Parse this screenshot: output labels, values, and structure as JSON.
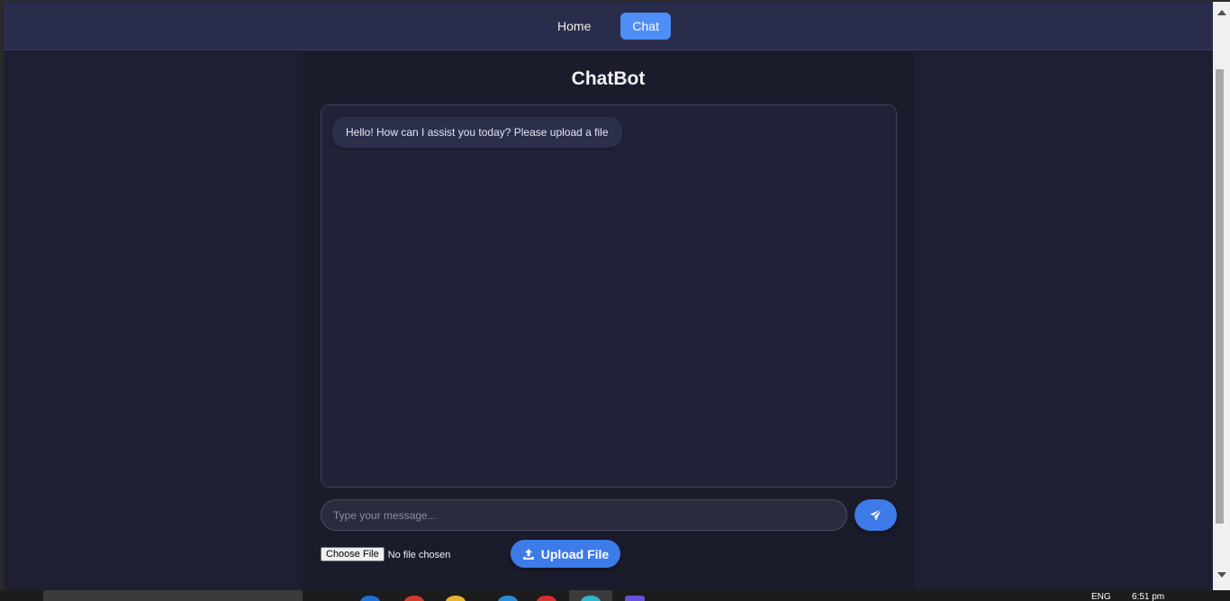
{
  "nav": {
    "items": [
      {
        "label": "Home",
        "active": false
      },
      {
        "label": "Chat",
        "active": true
      }
    ]
  },
  "chat": {
    "title": "ChatBot",
    "messages": [
      {
        "sender": "bot",
        "text": "Hello! How can I assist you today? Please upload a file"
      }
    ],
    "input_placeholder": "Type your message...",
    "send_icon": "paper-plane-icon"
  },
  "file": {
    "choose_label": "Choose File",
    "status": "No file chosen",
    "upload_label": "Upload File",
    "upload_icon": "upload-icon"
  },
  "taskbar": {
    "language": "ENG",
    "time": "6:51 pm"
  },
  "colors": {
    "accent": "#4f8ef7",
    "button": "#3d7be8",
    "navbar": "#292c4a",
    "background": "#1e1f30"
  }
}
